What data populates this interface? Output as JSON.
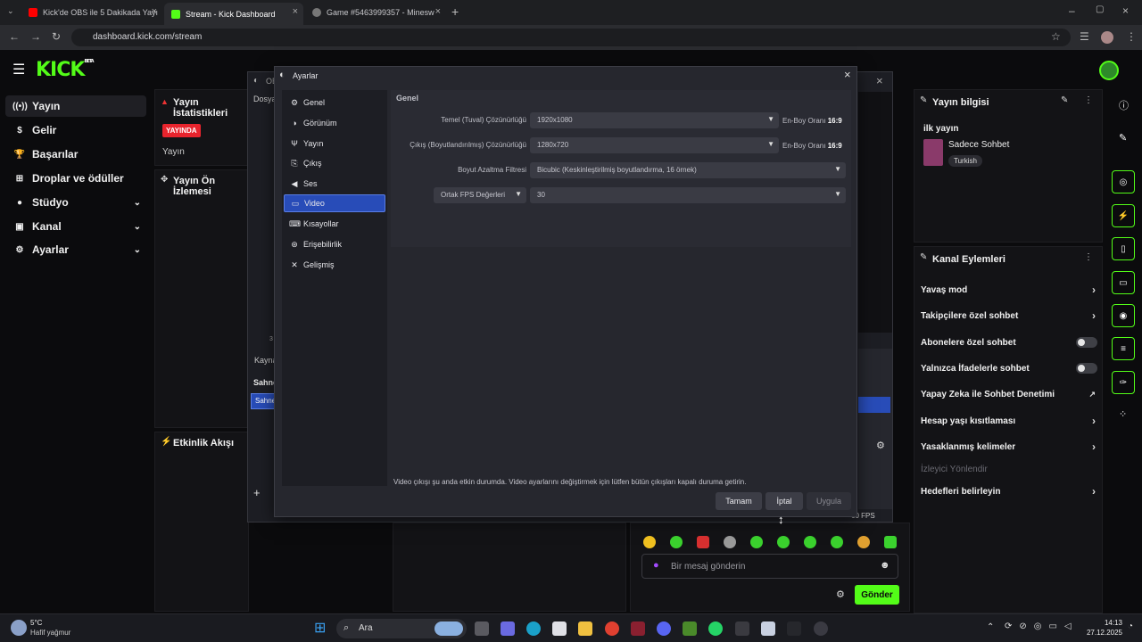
{
  "browser": {
    "tabs": [
      {
        "label": "Kick'de OBS ile 5 Dakikada Yayı",
        "color": "#ff0000"
      },
      {
        "label": "Stream - Kick Dashboard",
        "color": "#53fc18"
      },
      {
        "label": "Game #5463999357 - Minesw",
        "color": "#888888"
      }
    ],
    "url": "dashboard.kick.com/stream"
  },
  "kick": {
    "logo": "KICK",
    "logo_badge": "BETA",
    "nav": [
      {
        "label": "Yayın",
        "icon": "broadcast-icon"
      },
      {
        "label": "Gelir",
        "icon": "dollar-icon"
      },
      {
        "label": "Başarılar",
        "icon": "trophy-icon"
      },
      {
        "label": "Droplar ve ödüller",
        "icon": "gift-icon"
      },
      {
        "label": "Stüdyo",
        "icon": "studio-icon"
      },
      {
        "label": "Kanal",
        "icon": "channel-icon"
      },
      {
        "label": "Ayarlar",
        "icon": "gear-icon"
      }
    ],
    "stats_title": "Yayın İstatistikleri",
    "live_badge": "YAYINDA",
    "stream_label": "Yayın",
    "preview_title": "Yayın Ön İzlemesi",
    "activity_title": "Etkinlik Akışı",
    "stream_info": {
      "title": "Yayın bilgisi",
      "stream_name": "ilk yayın",
      "category": "Sadece Sohbet",
      "tag": "Turkish"
    },
    "channel_actions": {
      "title": "Kanal Eylemleri",
      "items": [
        {
          "label": "Yavaş mod",
          "control": "arrow"
        },
        {
          "label": "Takipçilere özel sohbet",
          "control": "arrow"
        },
        {
          "label": "Abonelere özel sohbet",
          "control": "toggle"
        },
        {
          "label": "Yalnızca İfadelerle sohbet",
          "control": "toggle"
        },
        {
          "label": "Yapay Zeka ile Sohbet Denetimi",
          "control": "external"
        },
        {
          "label": "Hesap yaşı kısıtlaması",
          "control": "arrow"
        },
        {
          "label": "Yasaklanmış kelimeler",
          "control": "arrow"
        },
        {
          "label": "İzleyici Yönlendir",
          "control": "disabled"
        },
        {
          "label": "Hedefleri belirleyin",
          "control": "arrow"
        }
      ]
    },
    "chat": {
      "placeholder": "Bir mesaj gönderin",
      "send_label": "Gönder"
    }
  },
  "obs": {
    "partial_labels": {
      "title": "OB",
      "menu": "Dosya",
      "sources": "Kayna",
      "scenes": "Sahne",
      "scene_item": "Sahne",
      "fps": "60 FPS",
      "timer": "3"
    },
    "settings": {
      "title": "Ayarlar",
      "sidebar": [
        {
          "label": "Genel",
          "icon": "gear-icon"
        },
        {
          "label": "Görünüm",
          "icon": "appearance-icon"
        },
        {
          "label": "Yayın",
          "icon": "antenna-icon"
        },
        {
          "label": "Çıkış",
          "icon": "output-icon"
        },
        {
          "label": "Ses",
          "icon": "speaker-icon"
        },
        {
          "label": "Video",
          "icon": "monitor-icon"
        },
        {
          "label": "Kısayollar",
          "icon": "keyboard-icon"
        },
        {
          "label": "Erişebilirlik",
          "icon": "accessibility-icon"
        },
        {
          "label": "Gelişmiş",
          "icon": "tools-icon"
        }
      ],
      "selected": "Video",
      "section": "Genel",
      "base_label": "Temel (Tuval) Çözünürlüğü",
      "base_value": "1920x1080",
      "output_label": "Çıkış (Boyutlandırılmış) Çözünürlüğü",
      "output_value": "1280x720",
      "ratio_label": "En-Boy Oranı",
      "ratio_value": "16:9",
      "filter_label": "Boyut Azaltma Filtresi",
      "filter_value": "Bicubic (Keskinleştirilmiş boyutlandırma, 16 örnek)",
      "fps_type": "Ortak FPS Değerleri",
      "fps_value": "30",
      "notice": "Video çıkışı şu anda etkin durumda. Video ayarlarını değiştirmek için lütfen bütün çıkışları kapalı duruma getirin.",
      "ok": "Tamam",
      "cancel": "İptal",
      "apply": "Uygula"
    }
  },
  "taskbar": {
    "weather_temp": "5°C",
    "weather_desc": "Hafif yağmur",
    "search": "Ara",
    "time": "14:13",
    "date": "27.12.2025"
  }
}
